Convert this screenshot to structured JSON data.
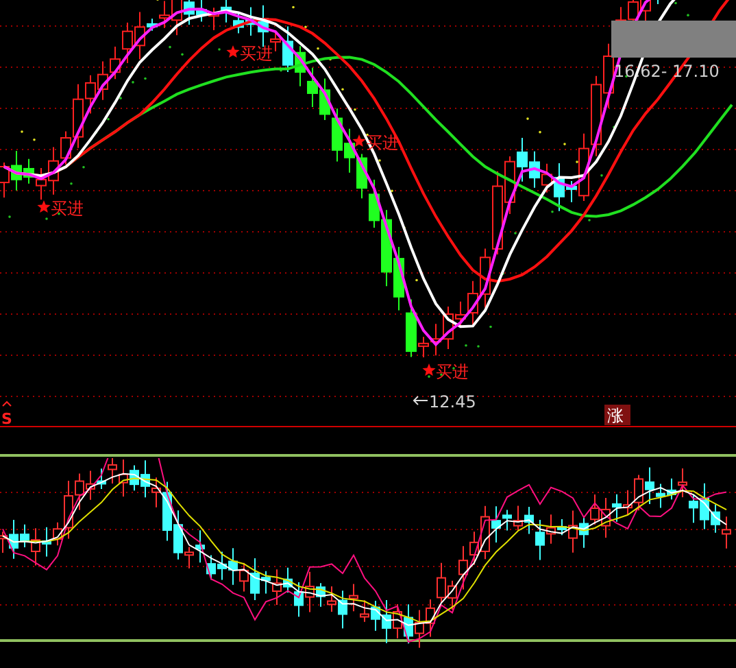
{
  "main_chart": {
    "buy_signals": [
      {
        "label": "买进"
      },
      {
        "label": "买进"
      },
      {
        "label": "买进"
      },
      {
        "label": "买进"
      }
    ],
    "low_marker": "12.45",
    "range_label": "16.62- 17.10",
    "s_marker": "S",
    "rise_badge": "涨"
  }
}
